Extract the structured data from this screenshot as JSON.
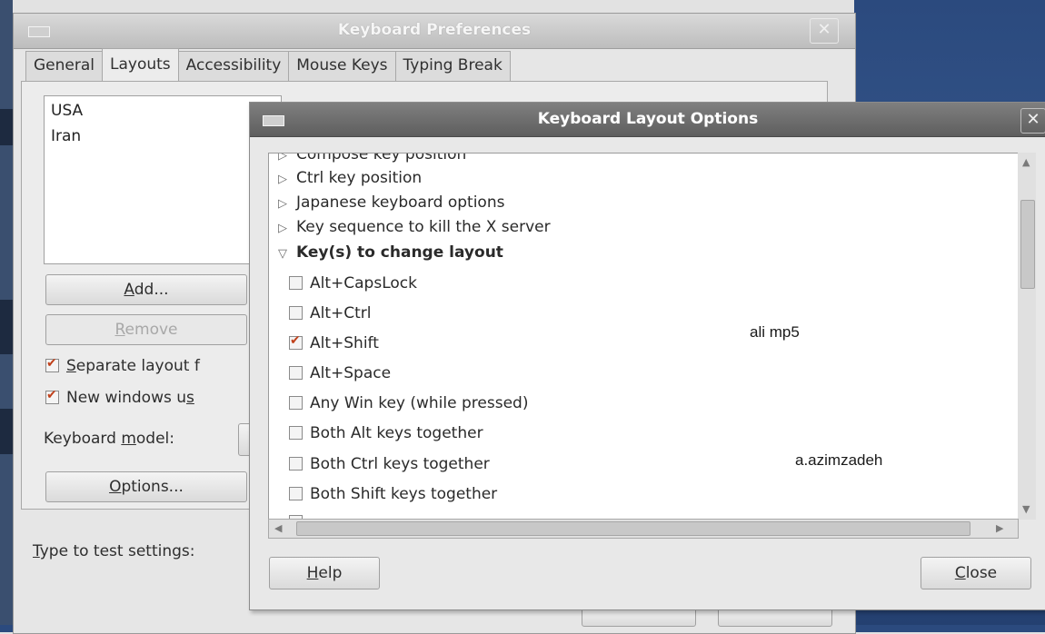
{
  "main_window": {
    "title": "Keyboard Preferences",
    "close_glyph": "✕",
    "tabs": [
      "General",
      "Layouts",
      "Accessibility",
      "Mouse Keys",
      "Typing Break"
    ],
    "active_tab": "Layouts",
    "layouts": [
      "USA",
      "Iran"
    ],
    "add_button": {
      "mnemonic": "A",
      "rest": "dd..."
    },
    "remove_button": {
      "mnemonic": "R",
      "rest": "emove"
    },
    "separate_layout": {
      "pre": "",
      "mnemonic": "S",
      "post": "eparate layout f",
      "checked": true
    },
    "new_windows": {
      "pre": "New windows u",
      "mnemonic": "s",
      "post": "",
      "checked": true
    },
    "keyboard_model_label": {
      "pre": "Keyboard ",
      "mnemonic": "m",
      "post": "odel:"
    },
    "options_button": {
      "mnemonic": "O",
      "rest": "ptions..."
    },
    "type_to_test": {
      "mnemonic": "T",
      "rest": "ype to test settings:"
    }
  },
  "dialog": {
    "title": "Keyboard Layout Options",
    "close_glyph": "✕",
    "tree": [
      {
        "label": "Compose key position",
        "expanded": false
      },
      {
        "label": "Ctrl key position",
        "expanded": false
      },
      {
        "label": "Japanese keyboard options",
        "expanded": false
      },
      {
        "label": "Key sequence to kill the X server",
        "expanded": false
      },
      {
        "label": "Key(s) to change layout",
        "expanded": true
      }
    ],
    "options": [
      {
        "label": "Alt+CapsLock",
        "checked": false
      },
      {
        "label": "Alt+Ctrl",
        "checked": false
      },
      {
        "label": "Alt+Shift",
        "checked": true
      },
      {
        "label": "Alt+Space",
        "checked": false
      },
      {
        "label": "Any Win key (while pressed)",
        "checked": false
      },
      {
        "label": "Both Alt keys together",
        "checked": false
      },
      {
        "label": "Both Ctrl keys together",
        "checked": false
      },
      {
        "label": "Both Shift keys together",
        "checked": false
      }
    ],
    "help_button": {
      "mnemonic": "H",
      "rest": "elp"
    },
    "close_button": {
      "mnemonic": "C",
      "rest": "lose"
    }
  },
  "overlay_text": {
    "note1": "ali mp5",
    "note2": "a.azimzadeh"
  },
  "icons": {
    "expander_closed": "triangle-right-icon",
    "expander_open": "triangle-down-icon",
    "scroll_up": "arrow-up-icon",
    "scroll_down": "arrow-down-icon",
    "scroll_left": "arrow-left-icon",
    "scroll_right": "arrow-right-icon"
  }
}
